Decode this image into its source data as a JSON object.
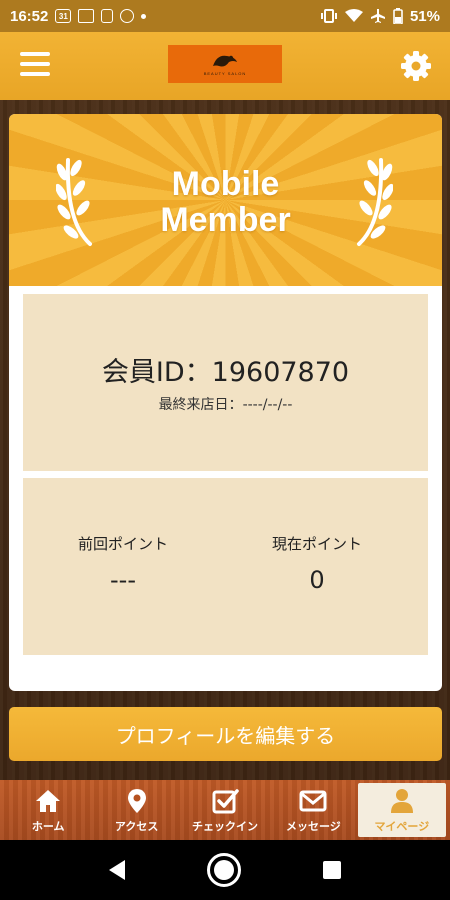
{
  "status_bar": {
    "time": "16:52",
    "calendar_day": "31",
    "battery": "51%",
    "icons": [
      "calendar-icon",
      "cast-icon",
      "sim-icon",
      "vpn-icon",
      "notification-dot-icon",
      "vibrate-icon",
      "wifi-icon",
      "airplane-icon",
      "battery-icon"
    ]
  },
  "header": {
    "menu_icon": "hamburger-menu-icon",
    "logo_text": "BEAUTY SALON",
    "settings_icon": "gear-icon"
  },
  "member_card": {
    "banner_title_line1": "Mobile",
    "banner_title_line2": "Member",
    "member_id_label": "会員ID：",
    "member_id": "19607870",
    "last_visit_label": "最終来店日：",
    "last_visit": "----/--/--",
    "previous_points_label": "前回ポイント",
    "previous_points": "---",
    "current_points_label": "現在ポイント",
    "current_points": "0"
  },
  "edit_profile_button": "プロフィールを編集する",
  "tabs": [
    {
      "label": "ホーム",
      "icon": "home-icon",
      "active": false
    },
    {
      "label": "アクセス",
      "icon": "map-pin-icon",
      "active": false
    },
    {
      "label": "チェックイン",
      "icon": "checkbox-icon",
      "active": false
    },
    {
      "label": "メッセージ",
      "icon": "envelope-icon",
      "active": false
    },
    {
      "label": "マイページ",
      "icon": "user-icon",
      "active": true
    }
  ],
  "colors": {
    "header": "#f2b334",
    "accent": "#eba82c",
    "panel": "#f2e2c4",
    "tab_bar": "#b5511f",
    "active_tab": "#e3a53a"
  }
}
